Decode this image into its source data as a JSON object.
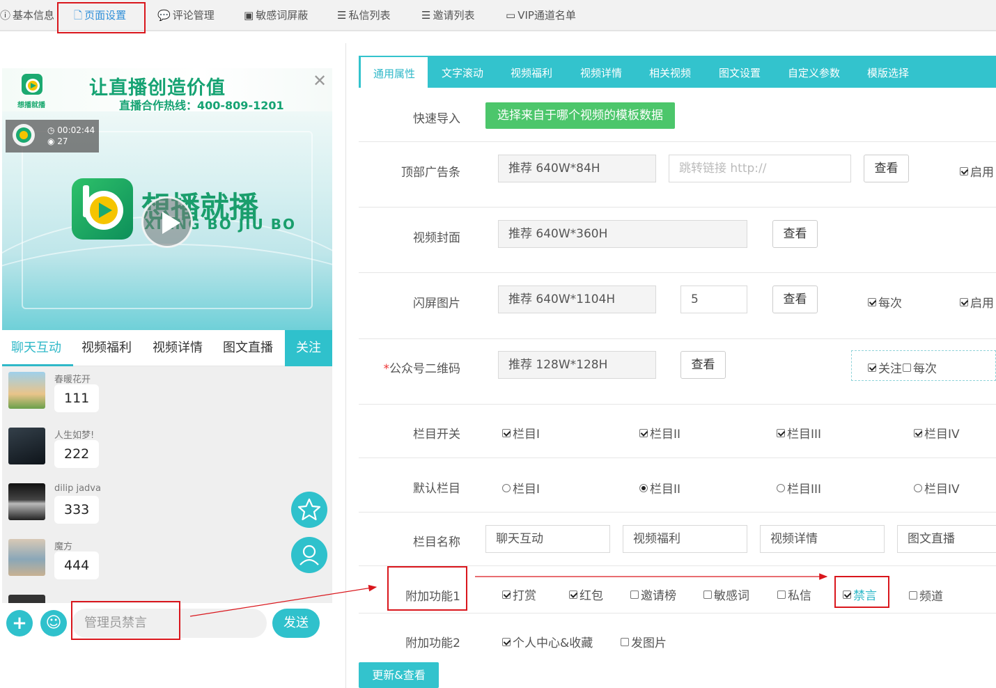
{
  "top_tabs": [
    {
      "label": "基本信息",
      "icon": "info-icon"
    },
    {
      "label": "页面设置",
      "icon": "page-icon",
      "active": true
    },
    {
      "label": "评论管理",
      "icon": "wechat-icon"
    },
    {
      "label": "敏感词屏蔽",
      "icon": "word-icon"
    },
    {
      "label": "私信列表",
      "icon": "list-icon"
    },
    {
      "label": "邀请列表",
      "icon": "list-icon"
    },
    {
      "label": "VIP通道名单",
      "icon": "card-icon"
    }
  ],
  "preview": {
    "banner_title": "让直播创造价值",
    "banner_sub": "直播合作热线：400-809-1201",
    "logo_text": "想播就播",
    "video_time": "00:02:44",
    "video_views": "27",
    "brand_cn": "想播就播",
    "brand_en": "XIANG BO JIU BO",
    "tabs": [
      "聊天互动",
      "视频福利",
      "视频详情",
      "图文直播"
    ],
    "follow": "关注",
    "messages": [
      {
        "name": "春暖花开",
        "text": "111"
      },
      {
        "name": "人生如梦!",
        "text": "222"
      },
      {
        "name": "dilip jadva",
        "text": "333"
      },
      {
        "name": "魔方",
        "text": "444"
      }
    ],
    "input_placeholder": "管理员禁言",
    "send": "发送"
  },
  "form_tabs": [
    "通用属性",
    "文字滚动",
    "视频福利",
    "视频详情",
    "相关视频",
    "图文设置",
    "自定义参数",
    "模版选择"
  ],
  "form": {
    "quick_import": {
      "label": "快速导入",
      "button": "选择来自于哪个视频的模板数据"
    },
    "top_ad": {
      "label": "顶部广告条",
      "value": "推荐 640W*84H",
      "link_placeholder": "跳转链接 http://",
      "view": "查看",
      "enable": "启用"
    },
    "cover": {
      "label": "视频封面",
      "value": "推荐 640W*360H",
      "view": "查看"
    },
    "splash": {
      "label": "闪屏图片",
      "value": "推荐 640W*1104H",
      "seconds": "5",
      "view": "查看",
      "every": "每次",
      "enable": "启用"
    },
    "qrcode": {
      "label": "公众号二维码",
      "required": "*",
      "value": "推荐 128W*128H",
      "view": "查看",
      "follow": "关注",
      "every": "每次"
    },
    "column_switch": {
      "label": "栏目开关",
      "items": [
        "栏目I",
        "栏目II",
        "栏目III",
        "栏目IV"
      ]
    },
    "default_column": {
      "label": "默认栏目",
      "items": [
        "栏目I",
        "栏目II",
        "栏目III",
        "栏目IV"
      ],
      "selected": 1
    },
    "column_names": {
      "label": "栏目名称",
      "values": [
        "聊天互动",
        "视频福利",
        "视频详情",
        "图文直播"
      ]
    },
    "extra1": {
      "label": "附加功能1",
      "items": [
        {
          "label": "打赏",
          "checked": true
        },
        {
          "label": "红包",
          "checked": true
        },
        {
          "label": "邀请榜",
          "checked": false
        },
        {
          "label": "敏感词",
          "checked": false
        },
        {
          "label": "私信",
          "checked": false
        },
        {
          "label": "禁言",
          "checked": true
        },
        {
          "label": "频道",
          "checked": false
        }
      ]
    },
    "extra2": {
      "label": "附加功能2",
      "items": [
        {
          "label": "个人中心&收藏",
          "checked": true
        },
        {
          "label": "发图片",
          "checked": false
        }
      ]
    },
    "update_button": "更新&查看"
  },
  "colors": {
    "accent": "#33c3cd",
    "green": "#4cc66b",
    "highlight": "#d9161c",
    "active_tab": "#2f8fd8"
  }
}
